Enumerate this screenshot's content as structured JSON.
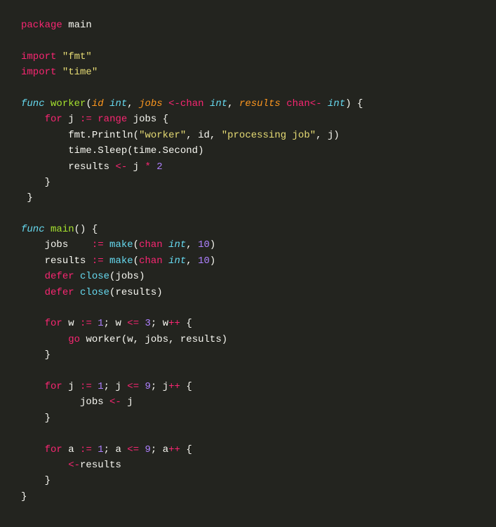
{
  "code": {
    "line1": {
      "package": "package",
      "main": "main"
    },
    "line3": {
      "import": "import",
      "fmt": "\"fmt\""
    },
    "line4": {
      "import": "import",
      "time": "\"time\""
    },
    "line6": {
      "func": "func",
      "name": "worker",
      "id": "id",
      "int1": "int",
      "jobs": "jobs",
      "chan1": "chan",
      "int2": "int",
      "results": "results",
      "chan2": "chan",
      "int3": "int"
    },
    "line7": {
      "for": "for",
      "j": "j",
      "op": ":=",
      "range": "range",
      "jobs": "jobs"
    },
    "line8": {
      "fmt": "fmt",
      "println": "Println",
      "worker": "\"worker\"",
      "id": "id",
      "processing": "\"processing job\"",
      "j": "j"
    },
    "line9": {
      "time1": "time",
      "sleep": "Sleep",
      "time2": "time",
      "second": "Second"
    },
    "line10": {
      "results": "results",
      "op1": "<-",
      "j": "j",
      "op2": "*",
      "two": "2"
    },
    "line14": {
      "func": "func",
      "name": "main"
    },
    "line15": {
      "jobs": "jobs",
      "op": ":=",
      "make": "make",
      "chan": "chan",
      "int": "int",
      "ten": "10"
    },
    "line16": {
      "results": "results",
      "op": ":=",
      "make": "make",
      "chan": "chan",
      "int": "int",
      "ten": "10"
    },
    "line17": {
      "defer": "defer",
      "close": "close",
      "jobs": "jobs"
    },
    "line18": {
      "defer": "defer",
      "close": "close",
      "results": "results"
    },
    "line20": {
      "for": "for",
      "w1": "w",
      "op1": ":=",
      "one": "1",
      "w2": "w",
      "op2": "<=",
      "three": "3",
      "w3": "w",
      "op3": "++"
    },
    "line21": {
      "go": "go",
      "worker": "worker",
      "w": "w",
      "jobs": "jobs",
      "results": "results"
    },
    "line24": {
      "for": "for",
      "j1": "j",
      "op1": ":=",
      "one": "1",
      "j2": "j",
      "op2": "<=",
      "nine": "9",
      "j3": "j",
      "op3": "++"
    },
    "line25": {
      "jobs": "jobs",
      "op": "<-",
      "j": "j"
    },
    "line28": {
      "for": "for",
      "a1": "a",
      "op1": ":=",
      "one": "1",
      "a2": "a",
      "op2": "<=",
      "nine": "9",
      "a3": "a",
      "op3": "++"
    },
    "line29": {
      "op": "<-",
      "results": "results"
    },
    "braces": {
      "open": "{",
      "close": "}",
      "openp": "(",
      "closep": ")",
      "comma": ", ",
      "dot": "."
    }
  }
}
